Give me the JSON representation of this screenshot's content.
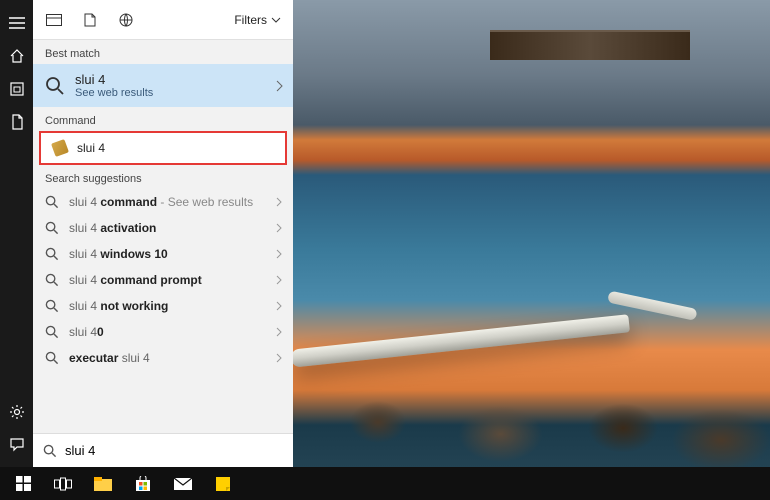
{
  "filters_label": "Filters",
  "sections": {
    "best_match": "Best match",
    "command": "Command",
    "suggestions": "Search suggestions"
  },
  "best": {
    "title": "slui 4",
    "subtitle": "See web results"
  },
  "command": {
    "title": "slui 4"
  },
  "suggestions": [
    {
      "prefix": "slui 4 ",
      "bold": "command",
      "hint": " - See web results"
    },
    {
      "prefix": "slui 4 ",
      "bold": "activation",
      "hint": ""
    },
    {
      "prefix": "slui 4 ",
      "bold": "windows 10",
      "hint": ""
    },
    {
      "prefix": "slui 4 ",
      "bold": "command prompt",
      "hint": ""
    },
    {
      "prefix": "slui 4 ",
      "bold": "not working",
      "hint": ""
    },
    {
      "prefix": "slui 4",
      "bold": "0",
      "hint": ""
    },
    {
      "prefix": "",
      "bold": "executar",
      "post": " slui 4",
      "hint": ""
    }
  ],
  "search_value": "slui 4",
  "colors": {
    "highlight_bg": "#cce4f7",
    "command_border": "#e53935",
    "taskbar_bg": "#101010"
  }
}
